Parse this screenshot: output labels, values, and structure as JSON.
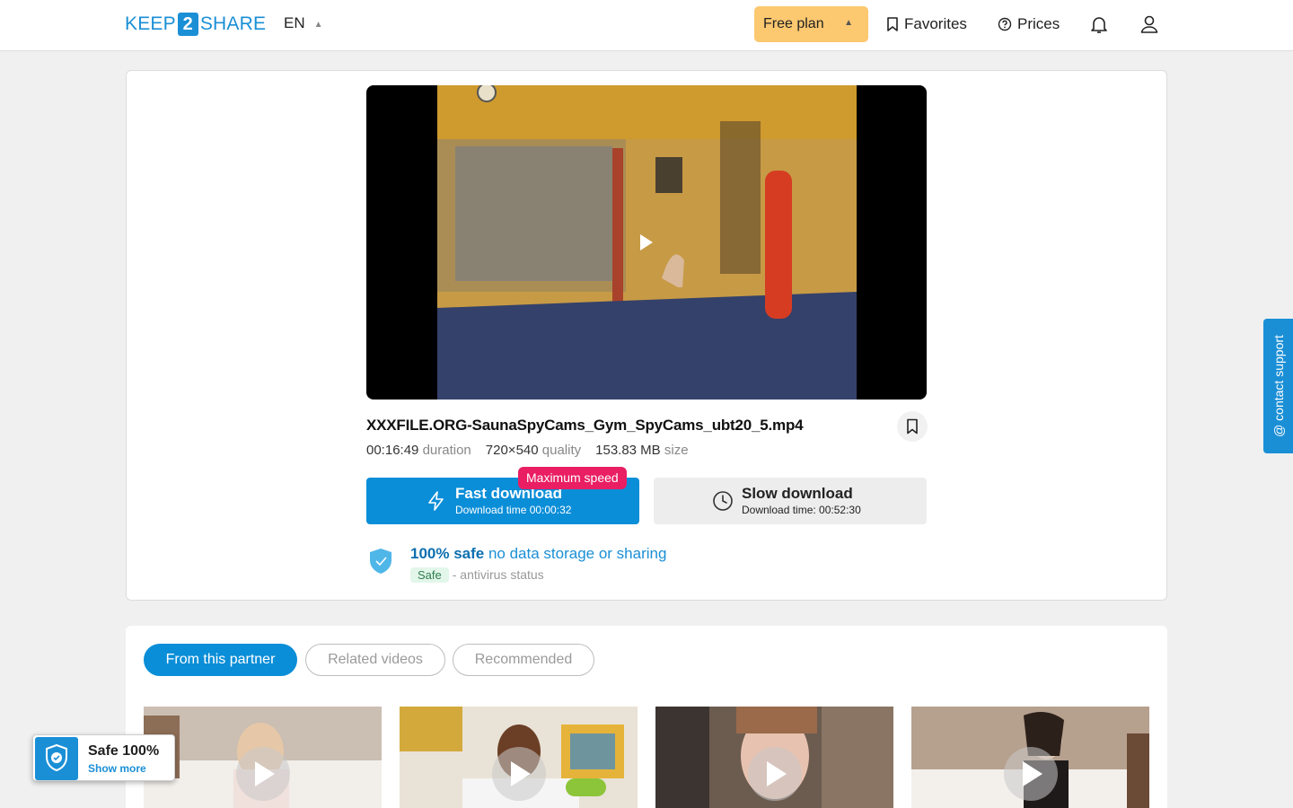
{
  "header": {
    "logo": {
      "left": "KEEP",
      "mid": "2",
      "right": "SHARE"
    },
    "language": "EN",
    "plan_label": "Free plan",
    "favorites_label": "Favorites",
    "prices_label": "Prices"
  },
  "file": {
    "name": "XXXFILE.ORG-SaunaSpyCams_Gym_SpyCams_ubt20_5.mp4",
    "duration_value": "00:16:49",
    "duration_label": "duration",
    "quality_value": "720×540",
    "quality_label": "quality",
    "size_value": "153.83 MB",
    "size_label": "size"
  },
  "download": {
    "badge": "Maximum speed",
    "fast_label": "Fast download",
    "fast_time": "Download time 00:00:32",
    "slow_label": "Slow download",
    "slow_time": "Download time: 00:52:30"
  },
  "safety": {
    "headline": "100% safe",
    "subline": "no data storage or sharing",
    "pill": "Safe",
    "status_text": "- antivirus status"
  },
  "contact_label": "@ contact support",
  "tabs": [
    {
      "label": "From this partner",
      "active": true
    },
    {
      "label": "Related videos",
      "active": false
    },
    {
      "label": "Recommended",
      "active": false
    }
  ],
  "safe_badge": {
    "title": "Safe 100%",
    "link": "Show more"
  },
  "colors": {
    "brand": "#1a8fd6",
    "fast_button": "#0b8ed8",
    "plan": "#fcc870",
    "badge": "#e91e63"
  }
}
